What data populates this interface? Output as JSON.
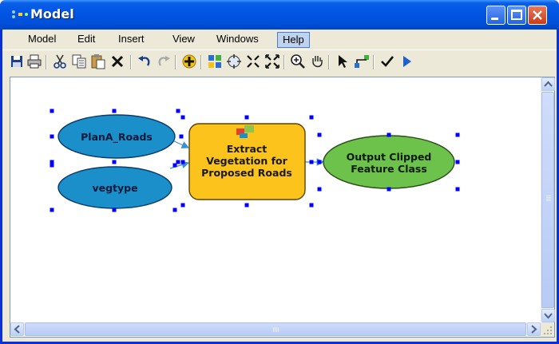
{
  "window": {
    "title": "Model"
  },
  "menu": [
    "Model",
    "Edit",
    "Insert",
    "View",
    "Windows",
    "Help"
  ],
  "diagram": {
    "inputs": [
      {
        "label": "PlanA_Roads"
      },
      {
        "label": "vegtype"
      }
    ],
    "tool": {
      "lines": [
        "Extract",
        "Vegetation for",
        "Proposed Roads"
      ]
    },
    "output": {
      "lines": [
        "Output Clipped",
        "Feature Class"
      ]
    }
  },
  "colors": {
    "input_fill": "#1a8fc9",
    "tool_fill": "#fbc31b",
    "output_fill": "#6cc24a",
    "selection_handle": "#0000ff"
  },
  "toolbar_icons": [
    "save-icon",
    "print-icon",
    "cut-icon",
    "copy-icon",
    "paste-icon",
    "delete-icon",
    "undo-icon",
    "redo-icon",
    "add-data-icon",
    "auto-layout-icon",
    "full-extent-icon",
    "zoom-in-fixed-icon",
    "zoom-out-fixed-icon",
    "zoom-in-icon",
    "pan-icon",
    "select-icon",
    "connect-icon",
    "validate-icon",
    "run-icon"
  ]
}
